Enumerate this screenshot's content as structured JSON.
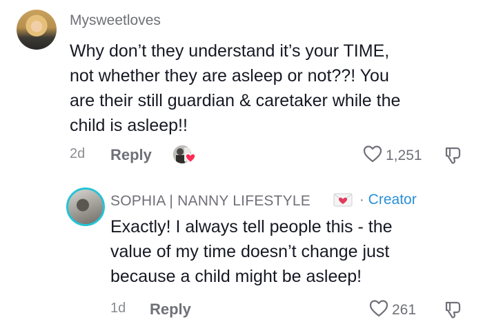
{
  "comments": [
    {
      "username": "Mysweetloves",
      "text_lines": [
        "Why don’t they understand it’s your TIME,",
        "not whether they are asleep or not??! You",
        "are their still guardian & caretaker while the",
        "child is asleep!!"
      ],
      "timestamp": "2d",
      "reply_label": "Reply",
      "likes": "1,251",
      "creator_liked": true
    },
    {
      "username": "SOPHIA | NANNY LIFESTYLE",
      "separator": "·",
      "badge": "Creator",
      "text_lines": [
        "Exactly! I always tell people this - the",
        "value of my time doesn’t change just",
        "because a child might be asleep!"
      ],
      "timestamp": "1d",
      "reply_label": "Reply",
      "likes": "261"
    }
  ],
  "colors": {
    "text": "#161823",
    "muted": "#6f7078",
    "creator_badge": "#2b8fd6",
    "heart_badge": "#fe2c55",
    "avatar_ring": "#25c3d6"
  },
  "icons": [
    "heart-icon",
    "dislike-icon",
    "envelope-heart-icon",
    "creator-liked-icon"
  ]
}
